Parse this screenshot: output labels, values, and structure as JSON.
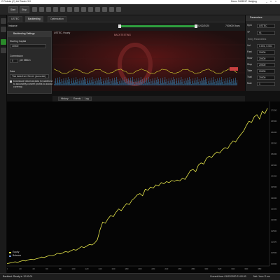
{
  "titlebar": {
    "title": "C Robots (C) Ltd Trader 3.0",
    "account": "Demo 9426917 Hedging",
    "min": "_",
    "max": "□",
    "close": "×"
  },
  "toolbar": {
    "start": "Start",
    "stop": "Stop"
  },
  "tabs": [
    "USTEC",
    "Backtesting",
    "Optimization"
  ],
  "progress": {
    "instance": "Instance",
    "end_date": "01/02/2020",
    "speed": "7000000 bars"
  },
  "settings": {
    "title": "Backtesting Settings",
    "starting_capital_label": "Starting Capital",
    "starting_capital": "10000",
    "commission_label": "Commission",
    "commission": "0",
    "commission_unit": "per Million",
    "data_label": "Data",
    "data_source": "Tick data from Server (accurate)",
    "download_1": "Download historical data for additional symbols",
    "download_2": "to accurately convert profits to account",
    "download_3": "currency"
  },
  "top_chart": {
    "symbol": "USTEC, Hourly",
    "watermark": "BACKTESTING"
  },
  "params": {
    "title": "Parameters",
    "section": "Entry Parameters",
    "rows": [
      {
        "label": "Sym",
        "value": "USTEC"
      },
      {
        "label": "TF",
        "value": "h1"
      },
      {
        "label": "Vol",
        "value": "0.001, 0.001"
      },
      {
        "label": "Fast",
        "value": "20000"
      },
      {
        "label": "Slow",
        "value": "20000"
      },
      {
        "label": "Stop",
        "value": "20000"
      },
      {
        "label": "Take",
        "value": "20000"
      },
      {
        "label": "Trail",
        "value": "20000"
      },
      {
        "label": "Mult",
        "value": "1"
      }
    ]
  },
  "result_tabs": [
    "History",
    "Events",
    "Log"
  ],
  "chart_data": {
    "type": "line",
    "x": [
      0,
      4,
      8,
      12,
      16,
      20,
      24,
      28,
      32,
      36,
      40,
      44,
      48,
      52,
      56,
      60,
      64,
      68,
      72,
      76,
      80,
      84,
      88,
      92,
      96,
      100,
      104,
      108,
      112,
      116,
      120,
      124,
      128,
      132,
      136,
      140,
      144,
      148,
      152,
      156,
      160,
      164,
      168,
      172,
      176,
      180,
      184,
      188,
      192,
      196,
      200,
      204,
      208,
      212,
      216,
      220,
      224,
      228,
      232,
      236,
      240,
      244,
      248,
      252,
      256,
      260,
      264,
      268,
      272,
      276,
      280,
      284,
      288,
      292,
      296,
      300,
      304,
      308,
      312,
      316,
      320,
      324,
      328,
      332,
      336,
      340,
      344,
      348,
      352,
      356,
      360,
      364,
      368,
      372,
      376,
      380,
      384,
      388,
      392
    ],
    "series": [
      {
        "name": "Equity",
        "values": [
          10010,
          10035,
          10060,
          10090,
          10070,
          10110,
          10150,
          10130,
          10180,
          10210,
          10190,
          10230,
          10260,
          10310,
          10290,
          10340,
          10380,
          10360,
          10410,
          10480,
          10450,
          10500,
          10560,
          10530,
          10590,
          10650,
          10620,
          10700,
          10780,
          10740,
          10810,
          10880,
          10860,
          10950,
          11100,
          11550,
          11900,
          11850,
          12050,
          12200,
          12150,
          12350,
          12500,
          12420,
          12600,
          12750,
          12700,
          12900,
          13000,
          13150,
          13200,
          13100,
          13400,
          13350,
          13500,
          13450,
          13600,
          13550,
          13700,
          13650,
          13750,
          13700,
          13800,
          13760,
          13820,
          13780,
          13900,
          13850,
          14050,
          14250,
          14300,
          14200,
          14500,
          14600,
          14550,
          14800,
          14900,
          14850,
          15000,
          15100,
          15050,
          15200,
          15300,
          15250,
          15450,
          15600,
          15550,
          15750,
          15900,
          16050,
          16300,
          16500,
          16450,
          16700,
          16800,
          16600,
          16950,
          16850,
          17100
        ]
      },
      {
        "name": "Balance",
        "values": []
      }
    ],
    "y_ticks": [
      10000,
      10500,
      11000,
      11500,
      12000,
      12500,
      13000,
      13500,
      14000,
      14500,
      15000,
      15500,
      16000,
      16500,
      17000
    ],
    "x_ticks": [
      0,
      20,
      40,
      60,
      80,
      100,
      120,
      140,
      160,
      180,
      200,
      220,
      240,
      260,
      280,
      300,
      320,
      340,
      360,
      380
    ],
    "ylim": [
      9900,
      17400
    ],
    "xlim": [
      0,
      395
    ],
    "legend": "bottom-left",
    "grid": false,
    "color": "#e5e54a"
  },
  "status": {
    "left": "Backtest: Ready in 12:00:01",
    "time": "Current time: 01/02/2020 21:00:00",
    "conn": "Net: 1ms / 0 ms"
  }
}
